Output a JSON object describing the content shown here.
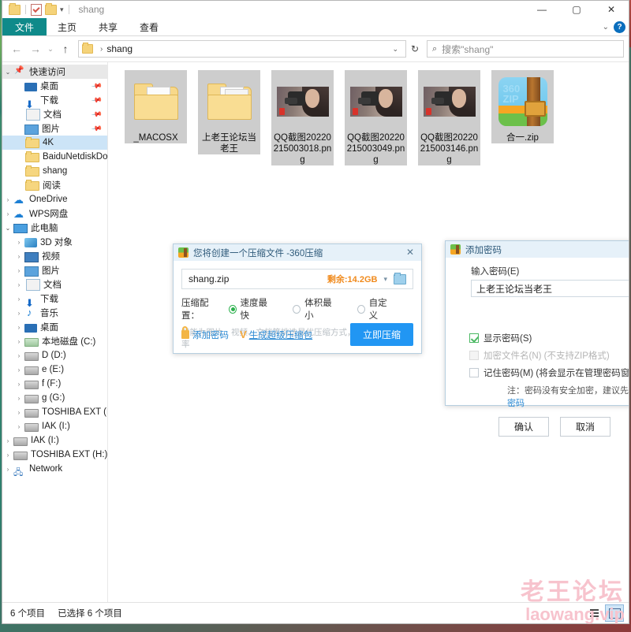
{
  "window": {
    "title": "shang",
    "quick_access_icons": [
      "folder-icon",
      "properties-icon",
      "new-folder-icon"
    ],
    "qat_caret": "▾",
    "minimize": "—",
    "maximize": "▢",
    "close": "✕"
  },
  "ribbon": {
    "tabs": [
      "文件",
      "主页",
      "共享",
      "查看"
    ],
    "expand_caret": "⌄",
    "help": "?"
  },
  "address": {
    "back": "←",
    "forward": "→",
    "recent": "⌄",
    "up": "↑",
    "crumb_root": "",
    "crumb_sep": "›",
    "crumb": "shang",
    "dropdown": "⌄",
    "refresh": "↻",
    "search_icon": "⌕",
    "search_placeholder": "搜索\"shang\""
  },
  "sidebar": {
    "items": [
      {
        "label": "快速访问",
        "icon": "pin-icon",
        "expand": "⌄",
        "indent": 0,
        "state": "header"
      },
      {
        "label": "桌面",
        "icon": "desktop-icon",
        "expand": "",
        "indent": 1,
        "pinned": true
      },
      {
        "label": "下载",
        "icon": "download-icon",
        "expand": "",
        "indent": 1,
        "pinned": true
      },
      {
        "label": "文档",
        "icon": "document-icon",
        "expand": "",
        "indent": 1,
        "pinned": true
      },
      {
        "label": "图片",
        "icon": "pictures-icon",
        "expand": "",
        "indent": 1,
        "pinned": true
      },
      {
        "label": "4K",
        "icon": "folder-icon",
        "expand": "",
        "indent": 1,
        "selected": true
      },
      {
        "label": "BaiduNetdiskDow",
        "icon": "folder-icon",
        "expand": "",
        "indent": 1
      },
      {
        "label": "shang",
        "icon": "folder-icon",
        "expand": "",
        "indent": 1
      },
      {
        "label": "阅读",
        "icon": "folder-icon",
        "expand": "",
        "indent": 1
      },
      {
        "label": "OneDrive",
        "icon": "cloud-icon",
        "expand": "›",
        "indent": 0
      },
      {
        "label": "WPS网盘",
        "icon": "cloud-icon",
        "expand": "›",
        "indent": 0
      },
      {
        "label": "此电脑",
        "icon": "computer-icon",
        "expand": "⌄",
        "indent": 0
      },
      {
        "label": "3D 对象",
        "icon": "3d-objects-icon",
        "expand": "›",
        "indent": 1
      },
      {
        "label": "视频",
        "icon": "videos-icon",
        "expand": "›",
        "indent": 1
      },
      {
        "label": "图片",
        "icon": "pictures-icon",
        "expand": "›",
        "indent": 1
      },
      {
        "label": "文档",
        "icon": "document-icon",
        "expand": "›",
        "indent": 1
      },
      {
        "label": "下载",
        "icon": "download-icon",
        "expand": "›",
        "indent": 1
      },
      {
        "label": "音乐",
        "icon": "music-icon",
        "expand": "›",
        "indent": 1
      },
      {
        "label": "桌面",
        "icon": "desktop-icon",
        "expand": "›",
        "indent": 1
      },
      {
        "label": "本地磁盘 (C:)",
        "icon": "drive-c-icon",
        "expand": "›",
        "indent": 1
      },
      {
        "label": "D (D:)",
        "icon": "drive-icon",
        "expand": "›",
        "indent": 1
      },
      {
        "label": "e (E:)",
        "icon": "drive-icon",
        "expand": "›",
        "indent": 1
      },
      {
        "label": "f (F:)",
        "icon": "drive-icon",
        "expand": "›",
        "indent": 1
      },
      {
        "label": "g (G:)",
        "icon": "drive-icon",
        "expand": "›",
        "indent": 1
      },
      {
        "label": "TOSHIBA EXT (H:)",
        "icon": "drive-icon",
        "expand": "›",
        "indent": 1
      },
      {
        "label": "IAK (I:)",
        "icon": "drive-icon",
        "expand": "›",
        "indent": 1
      },
      {
        "label": "IAK (I:)",
        "icon": "drive-icon",
        "expand": "›",
        "indent": 0
      },
      {
        "label": "TOSHIBA EXT (H:)",
        "icon": "drive-icon",
        "expand": "›",
        "indent": 0
      },
      {
        "label": "Network",
        "icon": "network-icon",
        "expand": "›",
        "indent": 0
      }
    ]
  },
  "files": [
    {
      "name": "_MACOSX",
      "type": "folder"
    },
    {
      "name": "上老王论坛当老王",
      "type": "folder"
    },
    {
      "name": "QQ截图20220215003018.png",
      "type": "image"
    },
    {
      "name": "QQ截图20220215003049.png",
      "type": "image"
    },
    {
      "name": "QQ截图20220215003146.png",
      "type": "image"
    },
    {
      "name": "合一.zip",
      "type": "archive"
    }
  ],
  "status": {
    "count": "6 个项目",
    "selected": "已选择 6 个项目",
    "view_list_icon": "list-view-icon",
    "view_thumb_icon": "thumbnail-view-icon"
  },
  "compress_dialog": {
    "title": "您将创建一个压缩文件 -360压缩",
    "close": "✕",
    "filename": "shang.zip",
    "free_space": "剩余:14.2GB",
    "dropdown_caret": "▾",
    "browse_icon": "folder-browse-icon",
    "config_label": "压缩配置：",
    "options": [
      "速度最快",
      "体积最小",
      "自定义"
    ],
    "selected_option": "速度最快",
    "description": "智能为图片、视频、文档等挑选最优压缩方式，兼具速度和压缩率",
    "add_password_link": "添加密码",
    "super_zip_link": "生成超级压缩包",
    "super_zip_mark": "V",
    "compress_button": "立即压缩"
  },
  "password_dialog": {
    "title": "添加密码",
    "close": "✕",
    "input_label": "输入密码(E)",
    "password_value": "上老王论坛当老王",
    "show_password": "显示密码(S)",
    "encrypt_filename": "加密文件名(N) (不支持ZIP格式)",
    "remember_password": "记住密码(M) (将会显示在管理密码窗口中)",
    "note_prefix": "注：密码没有安全加密，建议先 ",
    "note_link": "设置主密码",
    "ok_button": "确认",
    "cancel_button": "取消"
  },
  "watermark": {
    "line1": "老王论坛",
    "line2": "laowang.vip"
  },
  "colors": {
    "file_tab": "#0f8a8a",
    "accent_blue": "#2196f3",
    "link_blue": "#2b8ad4",
    "free_space_orange": "#f08a1c",
    "selected_nav": "#cce4f7",
    "watermark_pink": "#f7c3cd"
  }
}
